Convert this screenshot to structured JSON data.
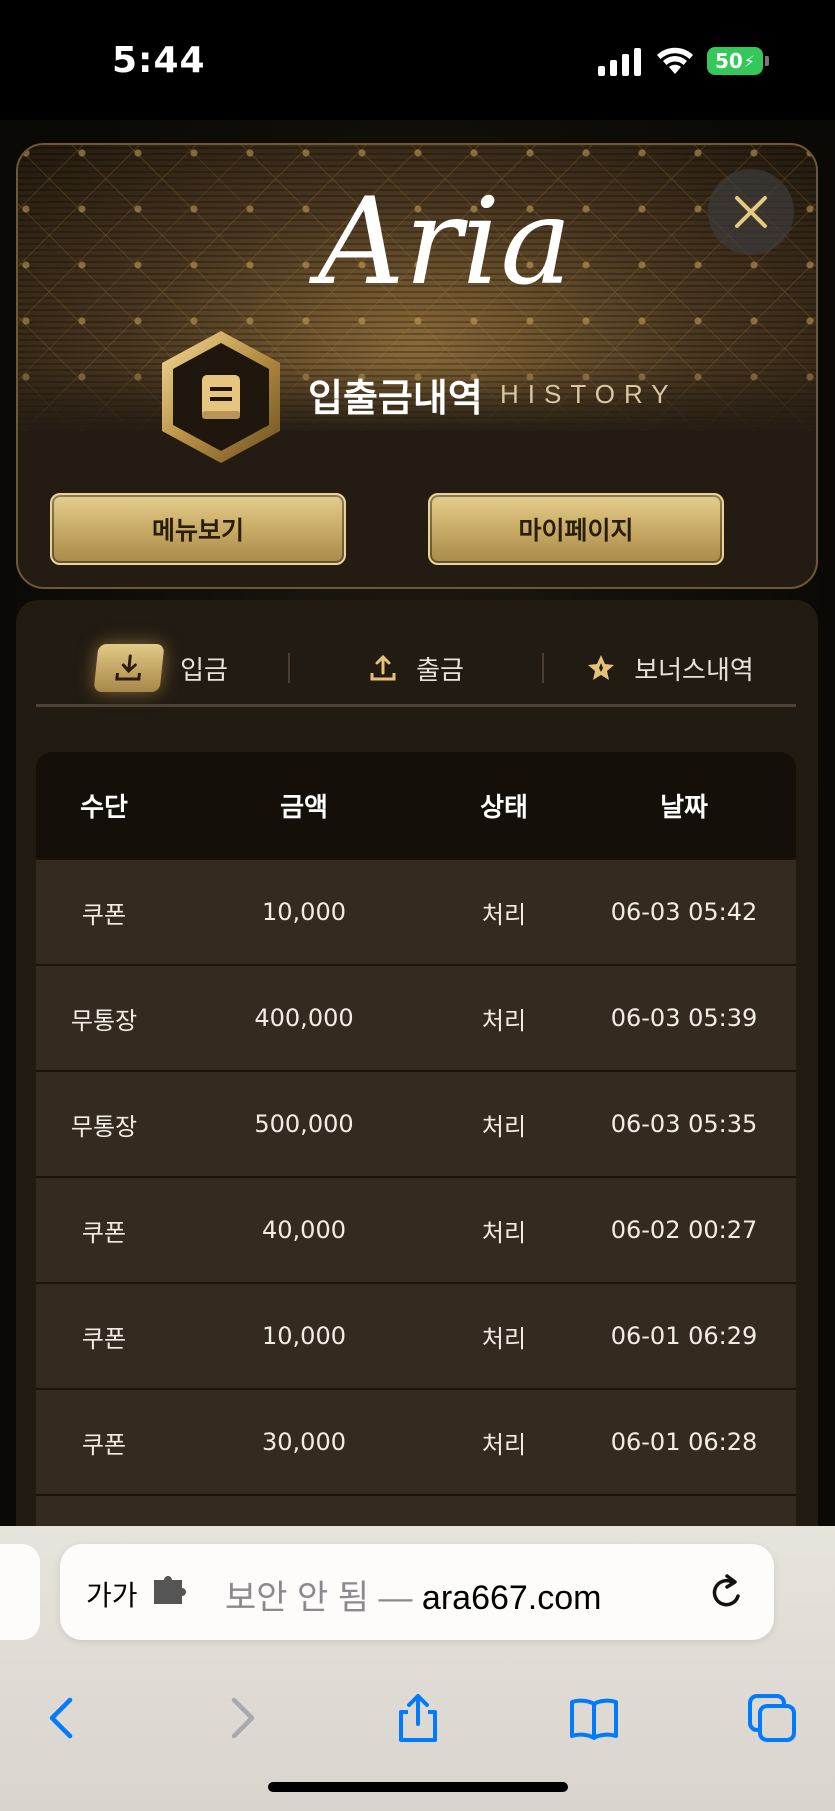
{
  "status_bar": {
    "time": "5:44",
    "battery": "50"
  },
  "header": {
    "logo_text": "Aria",
    "title": "입출금내역",
    "subtitle": "HISTORY",
    "menu_button": "메뉴보기",
    "mypage_button": "마이페이지"
  },
  "tabs": [
    {
      "label": "입금",
      "icon": "download-icon",
      "active": true
    },
    {
      "label": "출금",
      "icon": "upload-icon",
      "active": false
    },
    {
      "label": "보너스내역",
      "icon": "star-icon",
      "active": false
    }
  ],
  "table": {
    "headers": [
      "수단",
      "금액",
      "상태",
      "날짜"
    ],
    "rows": [
      [
        "쿠폰",
        "10,000",
        "처리",
        "06-03 05:42"
      ],
      [
        "무통장",
        "400,000",
        "처리",
        "06-03 05:39"
      ],
      [
        "무통장",
        "500,000",
        "처리",
        "06-03 05:35"
      ],
      [
        "쿠폰",
        "40,000",
        "처리",
        "06-02 00:27"
      ],
      [
        "쿠폰",
        "10,000",
        "처리",
        "06-01 06:29"
      ],
      [
        "쿠폰",
        "30,000",
        "처리",
        "06-01 06:28"
      ]
    ]
  },
  "browser": {
    "text_size_label": "가가",
    "security_label": "보안 안 됨 —",
    "domain": "ara667.com"
  },
  "colors": {
    "gold": "#d4b86f",
    "panel": "#221b12",
    "row": "#342a1f",
    "ios_blue": "#007aff"
  }
}
